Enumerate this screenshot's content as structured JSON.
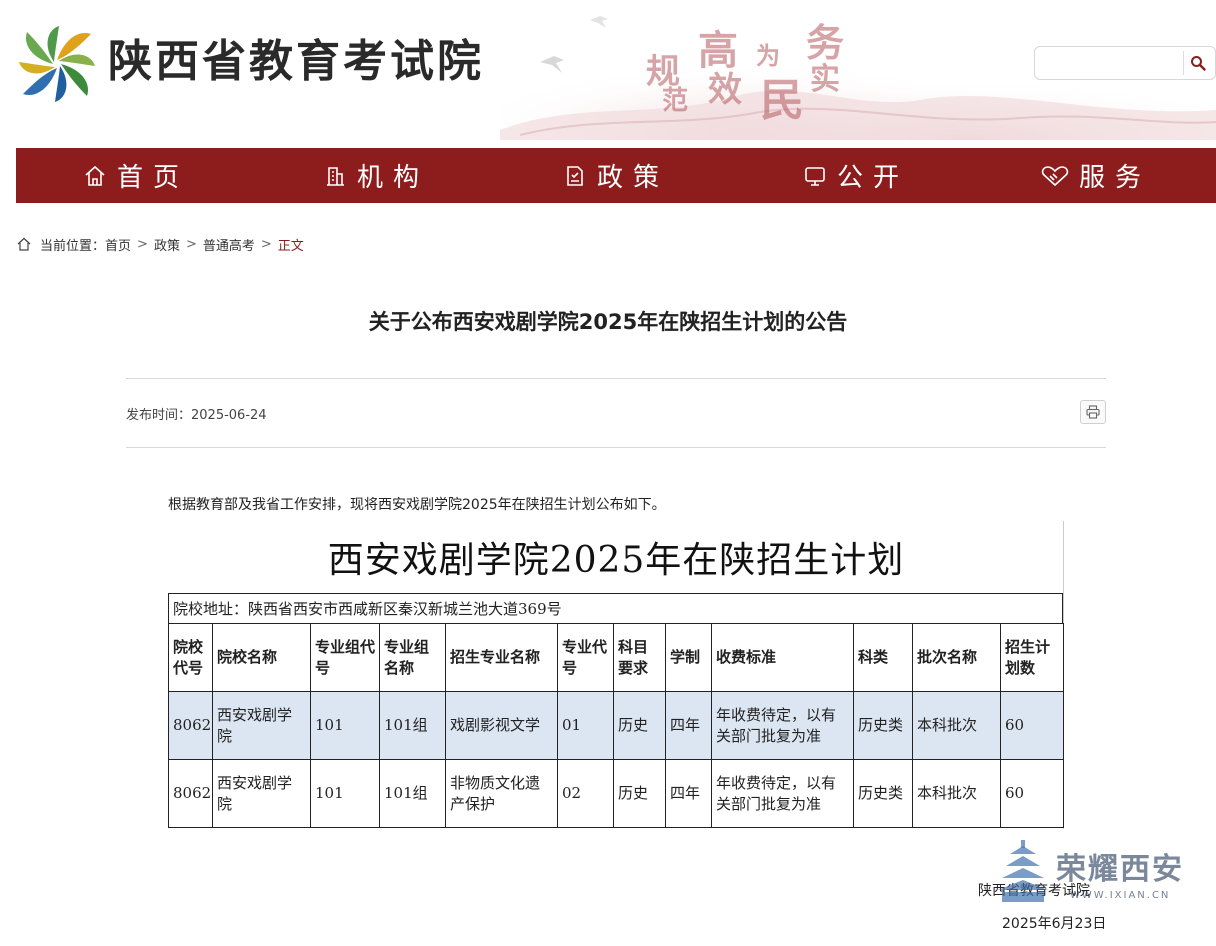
{
  "header": {
    "site_name": "陕西省教育考试院",
    "slogan": [
      "规",
      "范",
      "高",
      "效",
      "为",
      "民",
      "务",
      "实"
    ],
    "search": {
      "value": "",
      "placeholder": ""
    }
  },
  "nav": {
    "items": [
      {
        "label": "首页",
        "icon": "home-icon"
      },
      {
        "label": "机构",
        "icon": "building-icon"
      },
      {
        "label": "政策",
        "icon": "document-icon"
      },
      {
        "label": "公开",
        "icon": "monitor-icon"
      },
      {
        "label": "服务",
        "icon": "handshake-icon"
      }
    ]
  },
  "breadcrumb": {
    "prefix": "当前位置：",
    "items": [
      "首页",
      "政策",
      "普通高考"
    ],
    "current": "正文",
    "separator": ">"
  },
  "article": {
    "title": "关于公布西安戏剧学院2025年在陕招生计划的公告",
    "publish_label": "发布时间：",
    "publish_date": "2025-06-24",
    "intro": "根据教育部及我省工作安排，现将西安戏剧学院2025年在陕招生计划公布如下。",
    "signature_org": "陕西省教育考试院",
    "signature_date": "2025年6月23日"
  },
  "plan": {
    "title": "西安戏剧学院2025年在陕招生计划",
    "address": "院校地址：陕西省西安市西咸新区秦汉新城兰池大道369号",
    "headers": [
      "院校代号",
      "院校名称",
      "专业组代号",
      "专业组名称",
      "招生专业名称",
      "专业代号",
      "科目要求",
      "学制",
      "收费标准",
      "科类",
      "批次名称",
      "招生计划数"
    ],
    "rows": [
      [
        "8062",
        "西安戏剧学院",
        "101",
        "101组",
        "戏剧影视文学",
        "01",
        "历史",
        "四年",
        "年收费待定，以有关部门批复为准",
        "历史类",
        "本科批次",
        "60"
      ],
      [
        "8062",
        "西安戏剧学院",
        "101",
        "101组",
        "非物质文化遗产保护",
        "02",
        "历史",
        "四年",
        "年收费待定，以有关部门批复为准",
        "历史类",
        "本科批次",
        "60"
      ]
    ]
  },
  "watermark": {
    "text": "荣耀西安",
    "url": "WWW.IXIAN.CN"
  },
  "colors": {
    "nav_bg": "#8d1c1c",
    "current_crumb": "#8d1c1c",
    "row_highlight": "#dce6f2"
  }
}
